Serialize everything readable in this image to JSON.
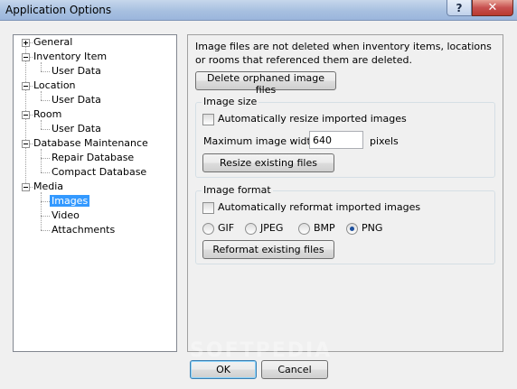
{
  "window": {
    "title": "Application Options",
    "help_glyph": "?",
    "close_glyph": "✕"
  },
  "tree": {
    "general": "General",
    "inventory_item": "Inventory Item",
    "inventory_user_data": "User Data",
    "location": "Location",
    "location_user_data": "User Data",
    "room": "Room",
    "room_user_data": "User Data",
    "database_maintenance": "Database Maintenance",
    "repair_database": "Repair Database",
    "compact_database": "Compact Database",
    "media": "Media",
    "images": "Images",
    "video": "Video",
    "attachments": "Attachments",
    "selected": "Images"
  },
  "panel": {
    "info_text": "Image files are not deleted when inventory items, locations or rooms that referenced them are deleted.",
    "delete_orphaned_label": "Delete orphaned image files",
    "image_size": {
      "group_label": "Image size",
      "auto_resize_label": "Automatically resize imported images",
      "auto_resize_checked": false,
      "max_width_label": "Maximum image width:",
      "max_width_value": "640",
      "pixels_label": "pixels",
      "resize_button_label": "Resize existing files"
    },
    "image_format": {
      "group_label": "Image format",
      "auto_reformat_label": "Automatically reformat imported images",
      "auto_reformat_checked": false,
      "formats": [
        "GIF",
        "JPEG",
        "BMP",
        "PNG"
      ],
      "selected_format": "PNG",
      "reformat_button_label": "Reformat existing files"
    }
  },
  "footer": {
    "ok_label": "OK",
    "cancel_label": "Cancel"
  },
  "watermark": "SOFTPEDIA"
}
